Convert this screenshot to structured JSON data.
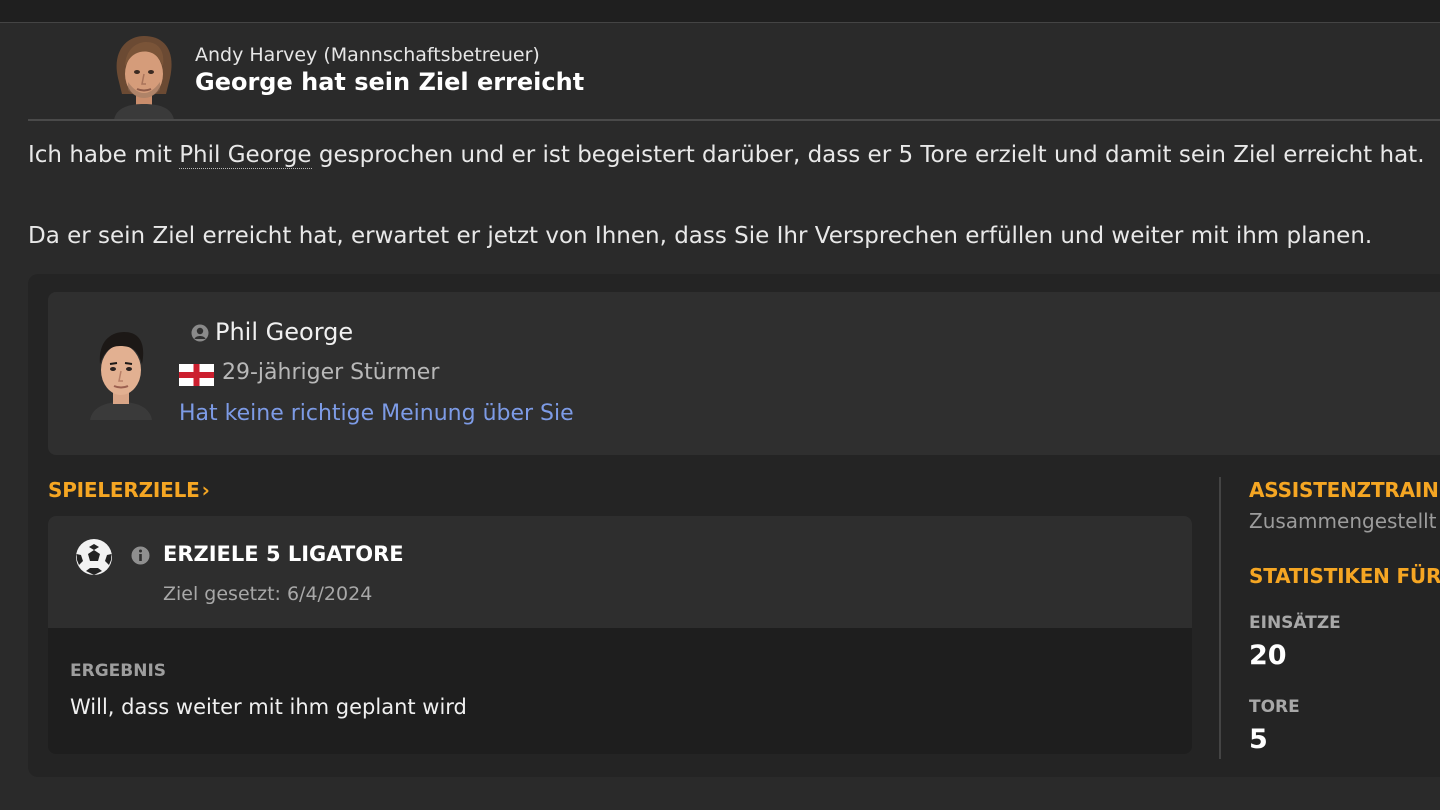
{
  "message": {
    "sender_name": "Andy Harvey",
    "sender_role": "(Mannschaftsbetreuer)",
    "subject": "George hat sein Ziel erreicht",
    "body1": {
      "before": "Ich habe mit ",
      "player_link": "Phil George",
      "after": " gesprochen und er ist begeistert darüber, dass er 5 Tore erzielt und damit sein Ziel erreicht hat."
    },
    "body2": "Da er sein Ziel erreicht hat, erwartet er jetzt von Ihnen, dass Sie Ihr Versprechen erfüllen und weiter mit ihm planen."
  },
  "player": {
    "name": "Phil George",
    "description": "29-jähriger Stürmer",
    "opinion": "Hat keine richtige Meinung über Sie"
  },
  "goals": {
    "section_title": "SPIELERZIELE",
    "chevron": "›",
    "goal_title": "ERZIELE 5 LIGATORE",
    "goal_date": "Ziel gesetzt: 6/4/2024",
    "result_label": "ERGEBNIS",
    "result_text": "Will, dass weiter mit ihm geplant wird"
  },
  "sidebar": {
    "assistant_title": "ASSISTENZTRAINER",
    "assistant_text": "Zusammengestellt",
    "stats_title": "STATISTIKEN FÜR",
    "stats": [
      {
        "label": "EINSÄTZE",
        "value": "20"
      },
      {
        "label": "TORE",
        "value": "5"
      }
    ]
  },
  "colors": {
    "accent": "#f5a623",
    "link": "#7d9be6",
    "background": "#2a2a2a"
  },
  "icons": [
    "manager-avatar",
    "player-avatar",
    "person-icon",
    "england-flag-icon",
    "football-icon",
    "info-icon"
  ]
}
